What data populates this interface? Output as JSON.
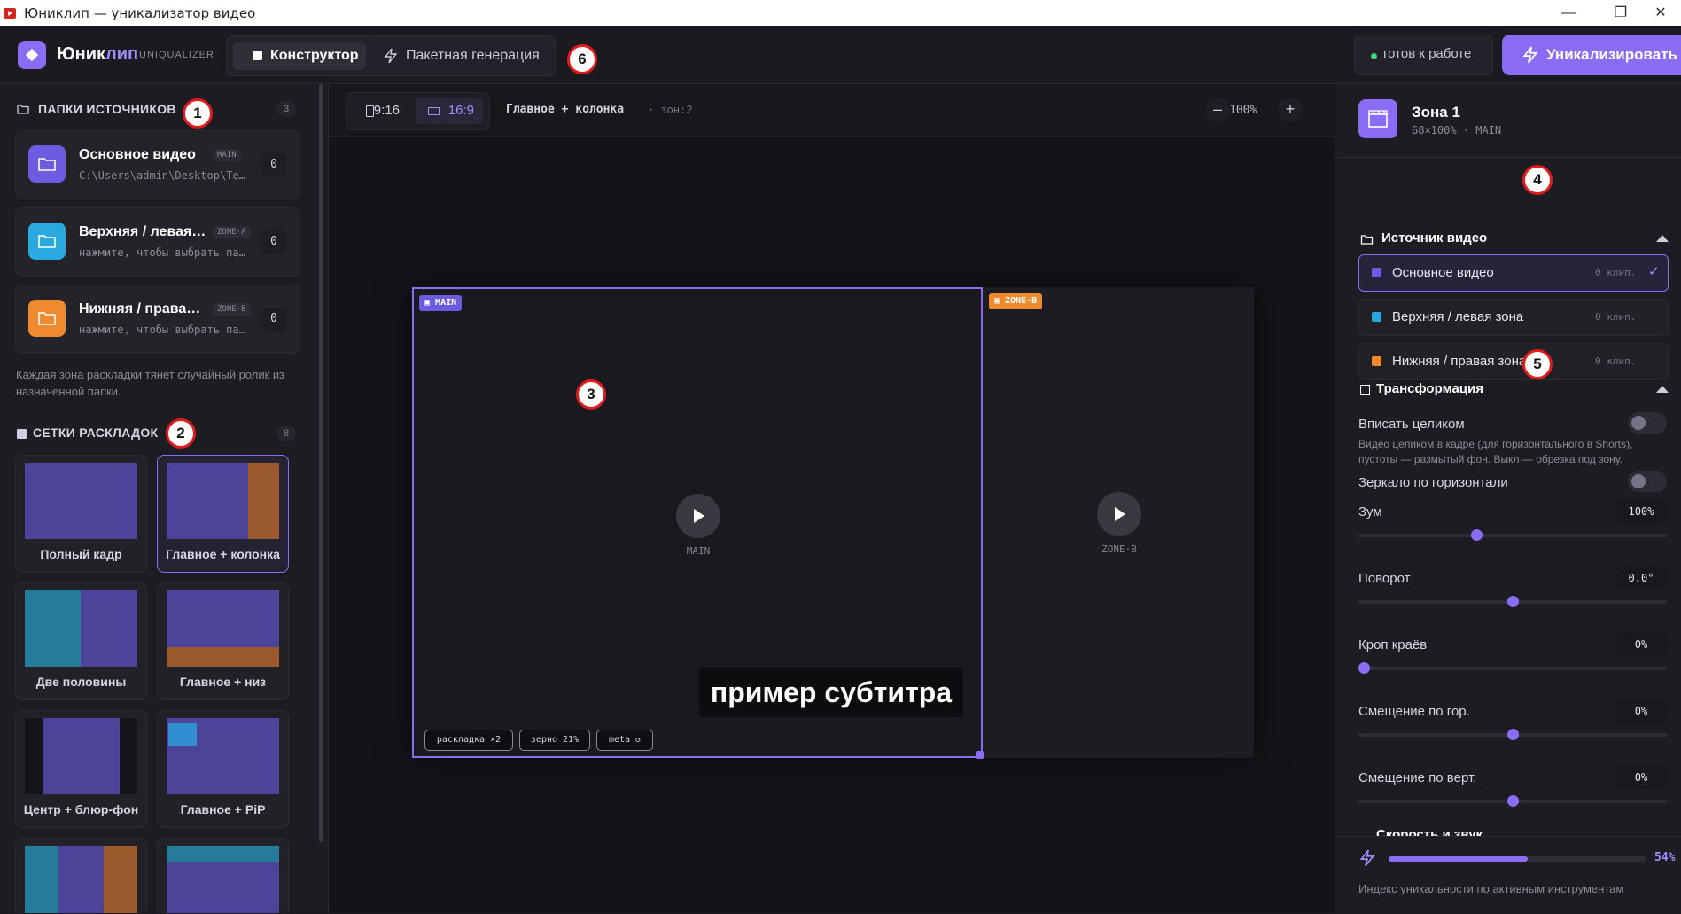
{
  "window": {
    "title": "Юниклип — уникализатор видео",
    "minimize": "—",
    "maximize": "❐",
    "close": "✕"
  },
  "header": {
    "brand_main": "Юник",
    "brand_accent": "лип",
    "brand_sub": "UNIQUALIZER",
    "tabs": [
      {
        "label": "Конструктор",
        "active": true
      },
      {
        "label": "Пакетная генерация",
        "active": false
      }
    ],
    "status": "готов к работе",
    "action": "Уникализировать"
  },
  "left": {
    "folders_title": "ПАПКИ ИСТОЧНИКОВ",
    "folders_count": "3",
    "folders": [
      {
        "name": "Основное видео",
        "path": "C:\\Users\\admin\\Desktop\\Te…",
        "tag": "MAIN",
        "count": "0",
        "color": "#6b5ce0"
      },
      {
        "name": "Верхняя / левая…",
        "path": "нажмите, чтобы выбрать па…",
        "tag": "ZONE·A",
        "count": "0",
        "color": "#2aa8e0"
      },
      {
        "name": "Нижняя / права…",
        "path": "нажмите, чтобы выбрать па…",
        "tag": "ZONE·B",
        "count": "0",
        "color": "#f08a2e"
      }
    ],
    "hint": "Каждая зона раскладки тянет случайный ролик из назначенной папки.",
    "grids_title": "СЕТКИ РАСКЛАДОК",
    "grids_count": "8",
    "grids": [
      "Полный кадр",
      "Главное + колонка",
      "Две половины",
      "Главное + низ",
      "Центр + блюр-фон",
      "Главное + PiP"
    ]
  },
  "center": {
    "ratio_a": "9:16",
    "ratio_b": "16:9",
    "layout_name": "Главное + колонка",
    "zones": "· зон:2",
    "zoom": "100%",
    "zoom_out": "–",
    "zoom_in": "+",
    "main_tag": "MAIN",
    "zoneb_tag": "ZONE·B",
    "main_label": "MAIN",
    "zoneb_label": "ZONE·B",
    "subtitle": "пример субтитра",
    "chips": [
      "раскладка ×2",
      "зерно 21%",
      "meta ↺"
    ]
  },
  "right": {
    "zone_title": "Зона 1",
    "zone_sub": "68×100% · MAIN",
    "source_title": "Источник видео",
    "sources": [
      {
        "name": "Основное видео",
        "clips": "0 клип.",
        "color": "#6b5ce0",
        "selected": true
      },
      {
        "name": "Верхняя / левая зона",
        "clips": "0 клип.",
        "color": "#2aa8e0",
        "selected": false
      },
      {
        "name": "Нижняя / правая зона",
        "clips": "0 клип.",
        "color": "#f08a2e",
        "selected": false
      }
    ],
    "checkmark": "✓",
    "transform_title": "Трансформация",
    "fit_label": "Вписать целиком",
    "fit_desc": "Видео целиком в кадре (для горизонтального в Shorts), пустоты — размытый фон. Выкл — обрезка под зону.",
    "fit_on": false,
    "mirror_label": "Зеркало по горизонтали",
    "mirror_on": false,
    "sliders": [
      {
        "label": "Зум",
        "value": "100%",
        "pos": 0.38
      },
      {
        "label": "Поворот",
        "value": "0.0°",
        "pos": 0.5
      },
      {
        "label": "Кроп краёв",
        "value": "0%",
        "pos": 0.0
      },
      {
        "label": "Смещение по гор.",
        "value": "0%",
        "pos": 0.5
      },
      {
        "label": "Смещение по верт.",
        "value": "0%",
        "pos": 0.5
      }
    ],
    "speed_title": "Скорость и звук",
    "uniq_pct": "54%",
    "uniq_fraction": 0.54,
    "uniq_note": "Индекс уникальности по активным инструментам"
  },
  "markers": [
    "1",
    "2",
    "3",
    "4",
    "5",
    "6"
  ]
}
